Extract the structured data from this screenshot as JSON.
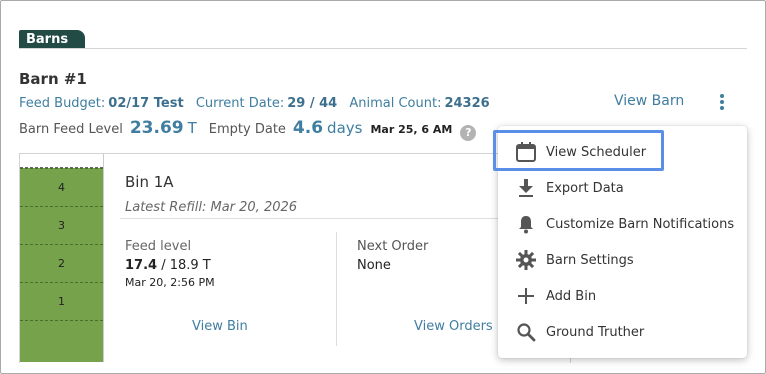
{
  "tab": {
    "label": "Barns"
  },
  "barn": {
    "title": "Barn #1",
    "feed_budget_label": "Feed Budget:",
    "feed_budget_value": "02/17 Test",
    "current_date_label": "Current Date:",
    "current_date_value": "29 / 44",
    "animal_count_label": "Animal Count:",
    "animal_count_value": "24326",
    "view_barn_label": "View Barn",
    "feed_level_label": "Barn Feed Level",
    "feed_level_value": "23.69",
    "feed_level_unit": "T",
    "empty_date_label": "Empty Date",
    "empty_date_value": "4.6",
    "empty_date_unit": "days",
    "empty_date_date": "Mar 25, 6 AM",
    "help_glyph": "?"
  },
  "bin": {
    "name": "Bin 1A",
    "latest_refill": "Latest Refill: Mar 20, 2026",
    "fill_fraction": 0.92,
    "segments": [
      "4",
      "3",
      "2",
      "1"
    ],
    "feed_level_label": "Feed level",
    "feed_level_current": "17.4",
    "feed_level_total": " / 18.9 T",
    "feed_level_time": "Mar 20, 2:56 PM",
    "next_order_label": "Next Order",
    "next_order_value": "None",
    "view_bin_label": "View Bin",
    "view_orders_label": "View Orders"
  },
  "menu": {
    "items": [
      {
        "label": "View Scheduler",
        "icon": "calendar-icon",
        "highlighted": true
      },
      {
        "label": "Export Data",
        "icon": "download-icon"
      },
      {
        "label": "Customize Barn Notifications",
        "icon": "bell-icon"
      },
      {
        "label": "Barn Settings",
        "icon": "gear-icon"
      },
      {
        "label": "Add Bin",
        "icon": "plus-icon"
      },
      {
        "label": "Ground Truther",
        "icon": "search-icon"
      }
    ]
  },
  "colors": {
    "accent": "#3f7ea0",
    "tab_bg": "#234b45",
    "bin_fill": "#76a24b",
    "highlight": "#5b8ee6"
  }
}
